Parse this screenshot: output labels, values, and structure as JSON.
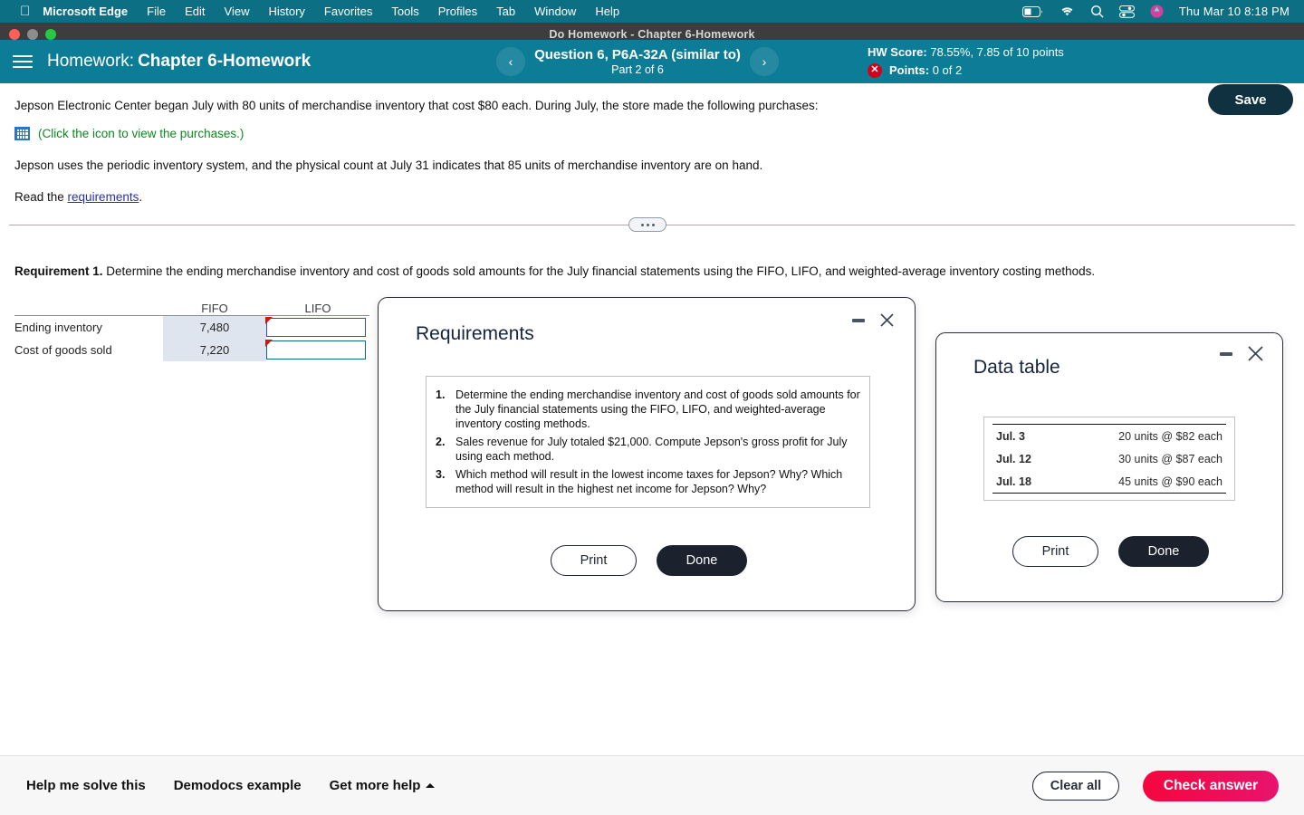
{
  "menubar": {
    "apple_icon": "apple-logo-icon",
    "items": [
      "Microsoft Edge",
      "File",
      "Edit",
      "View",
      "History",
      "Favorites",
      "Tools",
      "Profiles",
      "Tab",
      "Window",
      "Help"
    ],
    "status_icons": [
      "battery-icon",
      "wifi-icon",
      "search-icon",
      "control-center-icon",
      "siri-icon"
    ],
    "clock": "Thu Mar 10  8:18 PM"
  },
  "window": {
    "title": "Do Homework - Chapter 6-Homework",
    "traffic_lights": [
      "close-window-button",
      "minimize-window-button",
      "maximize-window-button"
    ]
  },
  "header": {
    "menu_icon": "hamburger-menu-icon",
    "label_prefix": "Homework:",
    "course_title": "Chapter 6-Homework",
    "prev_arrow": "‹",
    "next_arrow": "›",
    "question_title": "Question 6, P6A-32A (similar to)",
    "question_part": "Part 2 of 6",
    "hw_score_label": "HW Score:",
    "hw_score_value": "78.55%, 7.85 of 10 points",
    "points_label": "Points:",
    "points_value": "0 of 2",
    "error_badge": "✕",
    "settings_icon": "gear-icon",
    "save_label": "Save",
    "accent_color": "#0d7d97"
  },
  "problem": {
    "line1": "Jepson Electronic Center began July with 80 units of merchandise inventory that cost $80 each. During July, the store made the following purchases:",
    "icon_name": "spreadsheet-icon",
    "icon_link": "(Click the icon to view the purchases.)",
    "line2": "Jepson uses the periodic inventory system, and the physical count at July 31 indicates that 85 units of merchandise inventory are on hand.",
    "read_prefix": "Read the ",
    "read_link": "requirements",
    "read_suffix": "."
  },
  "requirement1": {
    "label": "Requirement 1.",
    "text": " Determine the ending merchandise inventory and cost of goods sold amounts for the July financial statements using the FIFO, LIFO, and weighted-average inventory costing methods."
  },
  "answer_table": {
    "columns": [
      "FIFO",
      "LIFO"
    ],
    "rows": [
      {
        "label": "Ending inventory",
        "fifo": "7,480",
        "lifo": "",
        "flag": true
      },
      {
        "label": "Cost of goods sold",
        "fifo": "7,220",
        "lifo": "",
        "flag": true
      }
    ]
  },
  "requirements_dialog": {
    "title": "Requirements",
    "minimize_icon": "minimize-icon",
    "close_icon": "close-icon",
    "items": [
      {
        "num": "1.",
        "text": "Determine the ending merchandise inventory and cost of goods sold amounts for the July financial statements using the FIFO, LIFO, and weighted-average inventory costing methods."
      },
      {
        "num": "2.",
        "text": "Sales revenue for July totaled $21,000. Compute Jepson's gross profit for July using each method."
      },
      {
        "num": "3.",
        "text": "Which method will result in the lowest income taxes for Jepson? Why? Which method will result in the highest net income for Jepson? Why?"
      }
    ],
    "print_label": "Print",
    "done_label": "Done"
  },
  "data_table_dialog": {
    "title": "Data table",
    "minimize_icon": "minimize-icon",
    "close_icon": "close-icon",
    "rows": [
      {
        "date": "Jul. 3",
        "detail": "20 units @ $82 each"
      },
      {
        "date": "Jul. 12",
        "detail": "30 units @ $87 each"
      },
      {
        "date": "Jul. 18",
        "detail": "45 units @ $90 each"
      }
    ],
    "print_label": "Print",
    "done_label": "Done"
  },
  "bottombar": {
    "help_me_solve": "Help me solve this",
    "demodocs": "Demodocs example",
    "get_more_help": "Get more help",
    "clear_all": "Clear all",
    "check_answer": "Check answer",
    "check_color": "#f5063e"
  }
}
